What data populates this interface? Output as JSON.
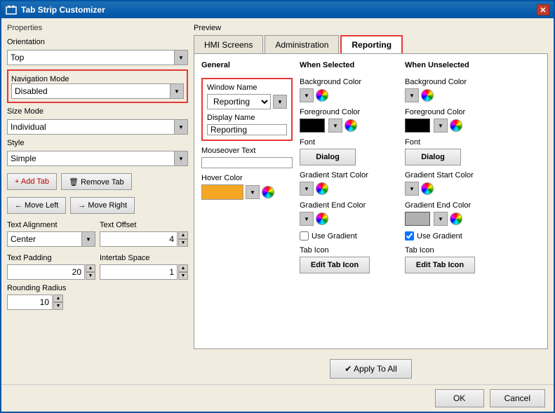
{
  "window": {
    "title": "Tab Strip Customizer",
    "close_label": "✕"
  },
  "left": {
    "properties_label": "Properties",
    "orientation_label": "Orientation",
    "orientation_value": "Top",
    "nav_mode_label": "Navigation Mode",
    "nav_mode_value": "Disabled",
    "size_mode_label": "Size Mode",
    "size_mode_value": "Individual",
    "style_label": "Style",
    "style_value": "Simple",
    "add_tab_label": "+ Add Tab",
    "remove_tab_label": "🗑 Remove Tab",
    "move_left_label": "← Move Left",
    "move_right_label": "→ Move Right",
    "text_alignment_label": "Text Alignment",
    "text_alignment_value": "Center",
    "text_offset_label": "Text Offset",
    "text_offset_value": "4",
    "text_padding_label": "Text Padding",
    "text_padding_value": "20",
    "intertab_space_label": "Intertab Space",
    "intertab_space_value": "1",
    "rounding_radius_label": "Rounding Radius",
    "rounding_radius_value": "10"
  },
  "preview": {
    "label": "Preview",
    "tabs": [
      {
        "label": "HMI Screens",
        "active": false
      },
      {
        "label": "Administration",
        "active": false
      },
      {
        "label": "Reporting",
        "active": true
      }
    ]
  },
  "general": {
    "title": "General",
    "window_name_label": "Window Name",
    "window_name_value": "Reporting",
    "display_name_label": "Display Name",
    "display_name_value": "Reporting",
    "mouseover_text_label": "Mouseover Text",
    "hover_color_label": "Hover Color"
  },
  "when_selected": {
    "title": "When Selected",
    "bg_color_label": "Background Color",
    "fg_color_label": "Foreground Color",
    "font_label": "Font",
    "font_btn": "Dialog",
    "gradient_start_label": "Gradient Start Color",
    "gradient_end_label": "Gradient End Color",
    "use_gradient_label": "Use Gradient",
    "use_gradient_checked": false,
    "tab_icon_label": "Tab Icon",
    "tab_icon_btn": "Edit Tab Icon"
  },
  "when_unselected": {
    "title": "When Unselected",
    "bg_color_label": "Background Color",
    "fg_color_label": "Foreground Color",
    "font_label": "Font",
    "font_btn": "Dialog",
    "gradient_start_label": "Gradient Start Color",
    "gradient_end_label": "Gradient End Color",
    "use_gradient_label": "Use Gradient",
    "use_gradient_checked": true,
    "tab_icon_label": "Tab Icon",
    "tab_icon_btn": "Edit Tab Icon"
  },
  "apply_btn": "✔ Apply To All",
  "footer": {
    "ok_label": "OK",
    "cancel_label": "Cancel"
  }
}
